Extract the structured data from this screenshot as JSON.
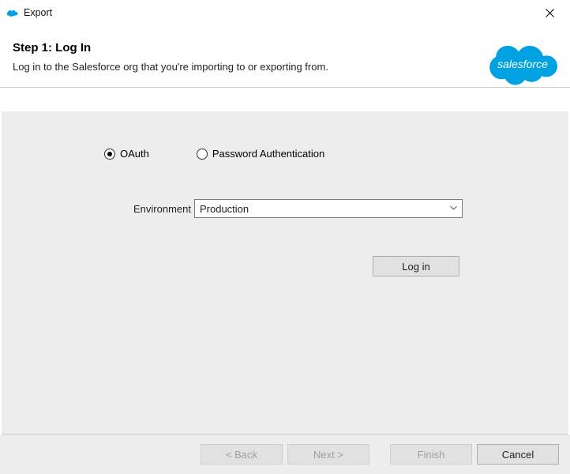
{
  "titlebar": {
    "title": "Export"
  },
  "header": {
    "step_title": "Step 1: Log In",
    "step_desc": "Log in to the Salesforce org that you're importing to or exporting from.",
    "logo_text": "salesforce"
  },
  "auth": {
    "oauth_label": "OAuth",
    "password_label": "Password Authentication",
    "selected": "oauth"
  },
  "environment": {
    "label": "Environment",
    "value": "Production"
  },
  "buttons": {
    "login": "Log in",
    "back": "< Back",
    "next": "Next >",
    "finish": "Finish",
    "cancel": "Cancel"
  }
}
